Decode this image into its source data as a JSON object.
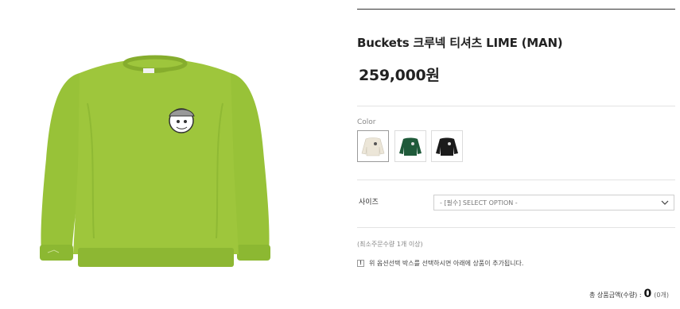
{
  "product": {
    "name": "Buckets 크루넥 티셔츠 LIME (MAN)",
    "price": "259,000원"
  },
  "image": {
    "description_icon": "sweatshirt-lime",
    "body_color": "#9bc43a",
    "shade_color": "#86ad2d"
  },
  "color_option": {
    "label": "Color",
    "swatches": [
      {
        "icon": "sweatshirt-cream",
        "color": "#efeadf"
      },
      {
        "icon": "sweatshirt-green",
        "color": "#1f5a3a"
      },
      {
        "icon": "sweatshirt-black",
        "color": "#1b1b1b"
      }
    ]
  },
  "size_option": {
    "label": "사이즈",
    "selected": "- [필수] SELECT OPTION -"
  },
  "min_order_text": "(최소주문수량 1개 이상)",
  "notice_text": "위 옵션선택 박스를 선택하시면 아래에 상품이 추가됩니다.",
  "total": {
    "label": "총 상품금액(수량) :",
    "amount": "0",
    "count": "(0개)"
  }
}
